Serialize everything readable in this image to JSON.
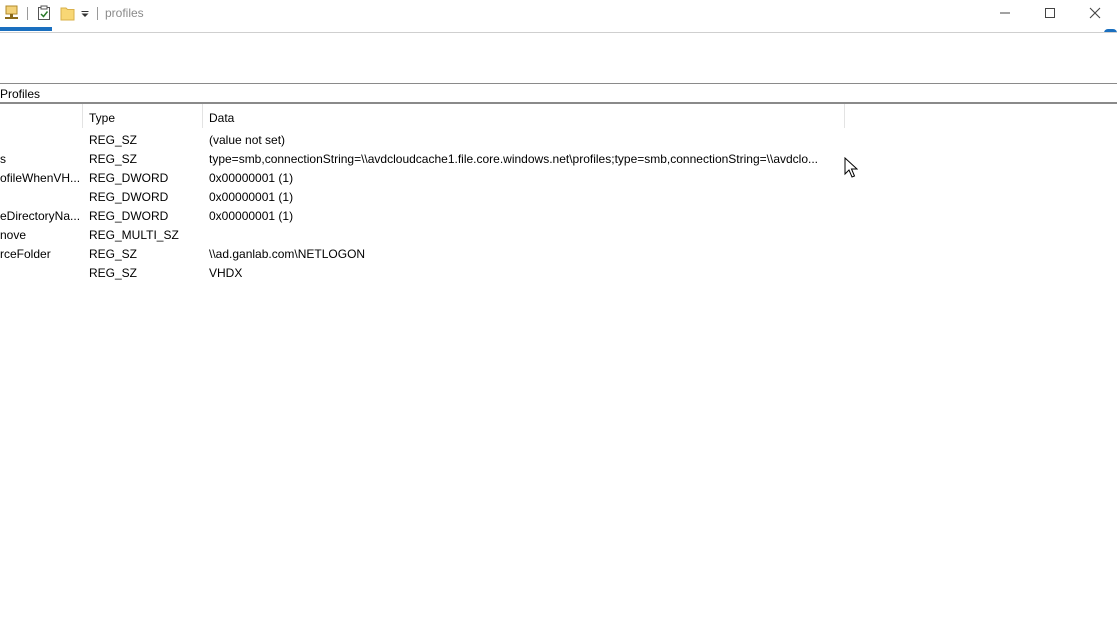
{
  "window": {
    "title": "profiles"
  },
  "address_bar": {
    "path": "Profiles"
  },
  "columns": {
    "type": "Type",
    "data": "Data"
  },
  "rows": [
    {
      "name": "",
      "type": "REG_SZ",
      "data": "(value not set)"
    },
    {
      "name": "s",
      "type": "REG_SZ",
      "data": "type=smb,connectionString=\\\\avdcloudcache1.file.core.windows.net\\profiles;type=smb,connectionString=\\\\avdclo..."
    },
    {
      "name": "ofileWhenVH...",
      "type": "REG_DWORD",
      "data": "0x00000001 (1)"
    },
    {
      "name": "",
      "type": "REG_DWORD",
      "data": "0x00000001 (1)"
    },
    {
      "name": "eDirectoryNa...",
      "type": "REG_DWORD",
      "data": "0x00000001 (1)"
    },
    {
      "name": "nove",
      "type": "REG_MULTI_SZ",
      "data": ""
    },
    {
      "name": "rceFolder",
      "type": "REG_SZ",
      "data": "\\\\ad.ganlab.com\\NETLOGON"
    },
    {
      "name": "",
      "type": "REG_SZ",
      "data": "VHDX"
    }
  ],
  "colors": {
    "accent": "#1a6fbf",
    "title_text": "#8a8a8a",
    "folder": "#f8d775"
  },
  "icons": {
    "quick_access": [
      "network-computer-icon",
      "properties-checkbox-icon",
      "folder-icon",
      "dropdown-arrow-icon"
    ],
    "window_controls": [
      "minimize-icon",
      "maximize-icon",
      "close-icon"
    ]
  }
}
